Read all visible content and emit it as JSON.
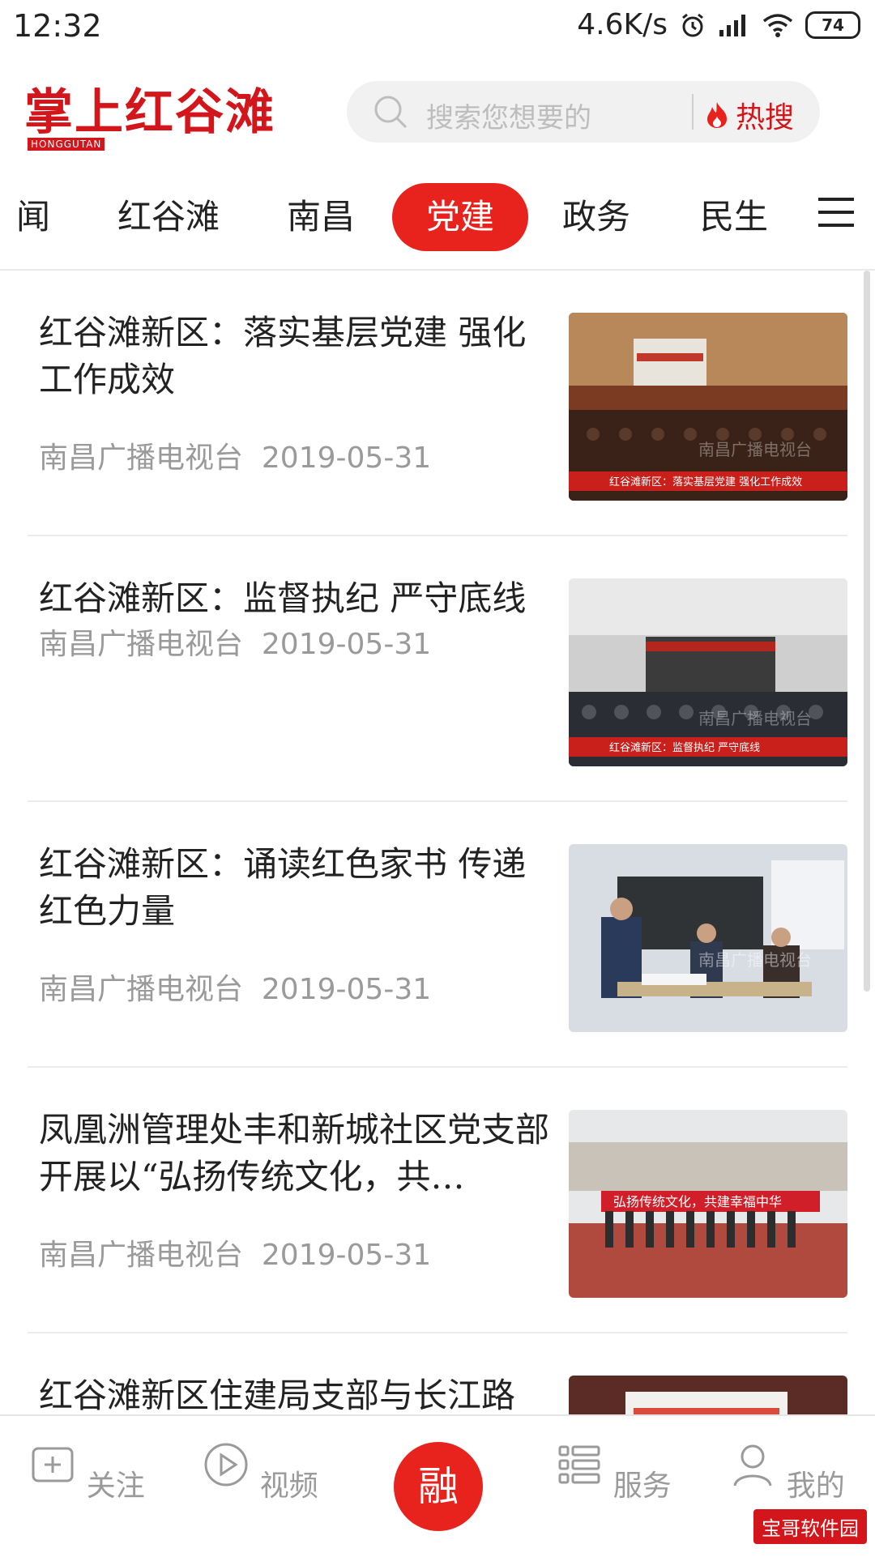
{
  "status_bar": {
    "time": "12:32",
    "speed": "4.6K/s",
    "battery": "74"
  },
  "header": {
    "logo_text": "掌上红谷滩",
    "logo_sub": "HONGGUTAN",
    "search_placeholder": "搜索您想要的",
    "hot_label": "热搜"
  },
  "tabs": [
    {
      "label": "闻",
      "active": false
    },
    {
      "label": "红谷滩",
      "active": false
    },
    {
      "label": "南昌",
      "active": false
    },
    {
      "label": "党建",
      "active": true
    },
    {
      "label": "政务",
      "active": false
    },
    {
      "label": "民生",
      "active": false
    }
  ],
  "articles": [
    {
      "title": "红谷滩新区：落实基层党建 强化工作成效",
      "source": "南昌广播电视台",
      "date": "2019-05-31",
      "thumb_caption": "红谷滩新区：落实基层党建 强化工作成效",
      "thumb_watermark": "南昌广播电视台"
    },
    {
      "title": "红谷滩新区：监督执纪 严守底线",
      "source": "南昌广播电视台",
      "date": "2019-05-31",
      "thumb_caption": "红谷滩新区：监督执纪 严守底线",
      "thumb_watermark": "南昌广播电视台"
    },
    {
      "title": "红谷滩新区：诵读红色家书 传递红色力量",
      "source": "南昌广播电视台",
      "date": "2019-05-31",
      "thumb_watermark": "南昌广播电视台"
    },
    {
      "title": "凤凰洲管理处丰和新城社区党支部开展以“弘扬传统文化，共…",
      "source": "南昌广播电视台",
      "date": "2019-05-31",
      "thumb_banner": "弘扬传统文化，共建幸福中华"
    },
    {
      "title": "红谷滩新区住建局支部与长江路",
      "source": "",
      "date": ""
    }
  ],
  "bottom_nav": [
    {
      "label": "关注"
    },
    {
      "label": "视频"
    },
    {
      "label": "融"
    },
    {
      "label": "服务"
    },
    {
      "label": "我的"
    }
  ],
  "watermark": "宝哥软件园",
  "colors": {
    "brand_red": "#e8231d",
    "text_dark": "#222222",
    "text_meta": "#9a9a9a"
  }
}
